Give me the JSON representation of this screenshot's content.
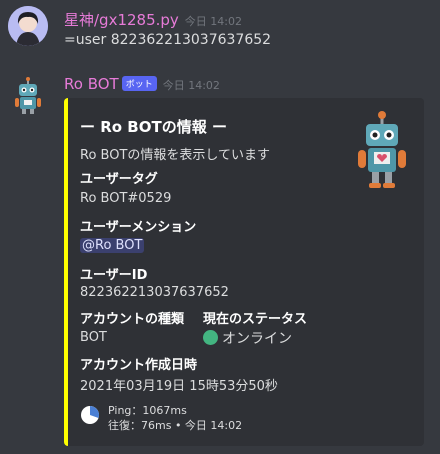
{
  "user_message": {
    "author": "星神/gx1285.py",
    "timestamp": "今日 14:02",
    "text": "=user 822362213037637652"
  },
  "bot_message": {
    "author": "Ro BOT",
    "badge": "ボット",
    "timestamp": "今日 14:02"
  },
  "embed": {
    "accent_color": "#ffff00",
    "title": "ー Ro BOTの情報 ー",
    "description": "Ro BOTの情報を表示しています",
    "fields": {
      "tag_name": "ユーザータグ",
      "tag_value": "Ro BOT#0529",
      "mention_name": "ユーザーメンション",
      "mention_value": "@Ro BOT",
      "id_name": "ユーザーID",
      "id_value": "822362213037637652",
      "type_name": "アカウントの種類",
      "type_value": "BOT",
      "status_name": "現在のステータス",
      "status_value": "オンライン",
      "status_color": "#43b581",
      "created_name": "アカウント作成日時",
      "created_value": "2021年03月19日 15時53分50秒"
    },
    "footer": {
      "line1": "Ping：1067ms",
      "line2": "往復：76ms • 今日 14:02"
    }
  }
}
